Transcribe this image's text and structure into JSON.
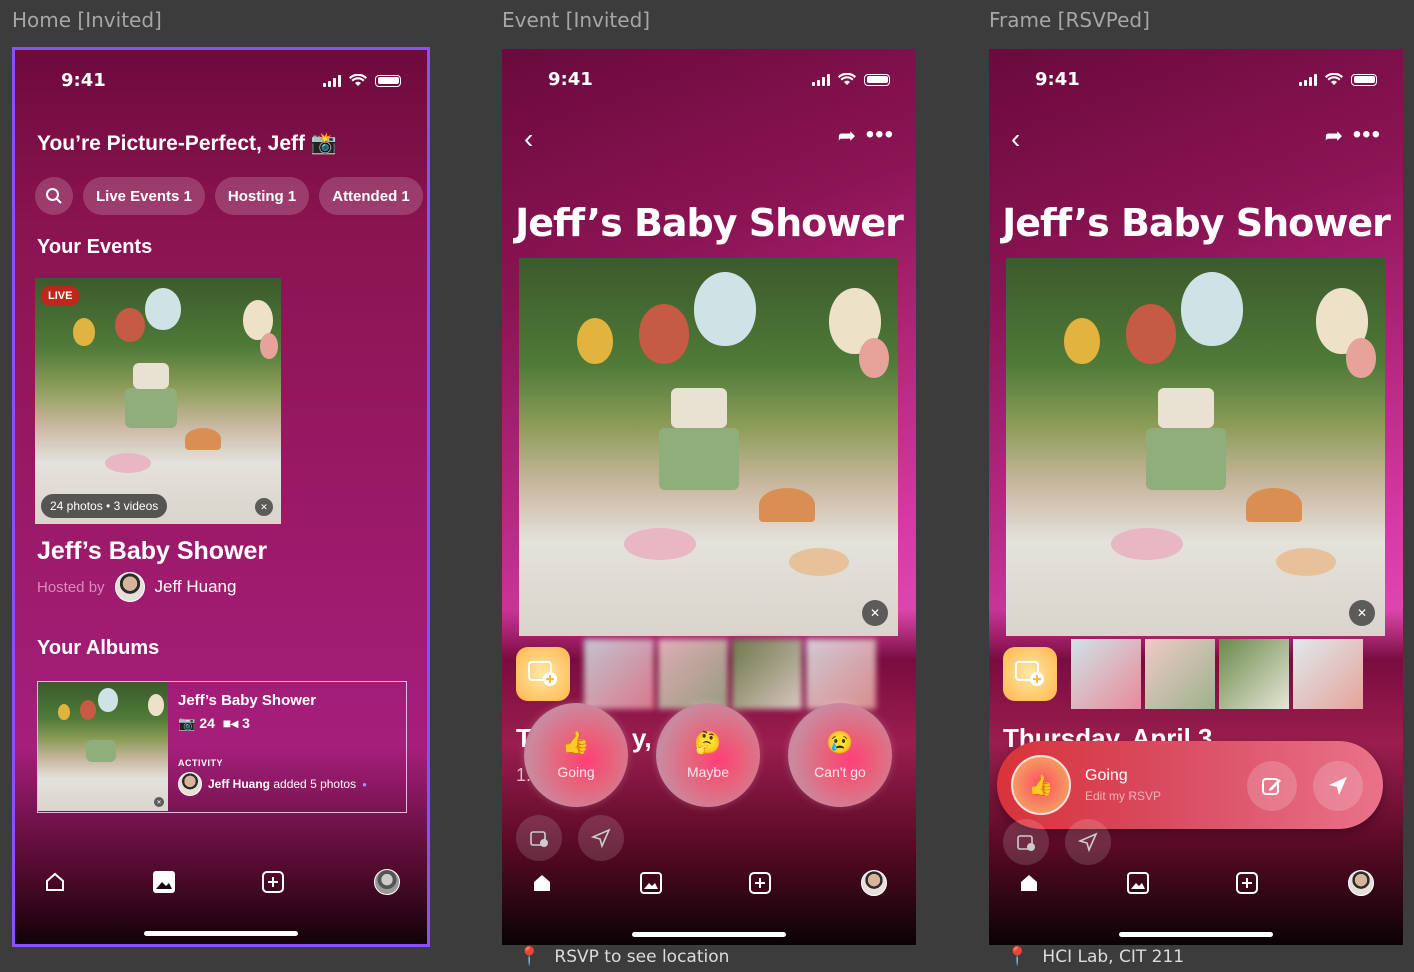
{
  "frames": {
    "home": "Home [Invited]",
    "event": "Event [Invited]",
    "rsvped": "Frame [RSVPed]"
  },
  "status": {
    "time": "9:41"
  },
  "home": {
    "greeting": "You’re Picture-Perfect, Jeff 📸",
    "chips": [
      "Live Events 1",
      "Hosting 1",
      "Attended 1"
    ],
    "your_events": "Your Events",
    "live_badge": "LIVE",
    "media_count": "24 photos • 3 videos",
    "event_title": "Jeff’s Baby Shower",
    "hosted_by": "Hosted by",
    "host_name": "Jeff Huang",
    "your_albums": "Your Albums",
    "album": {
      "title": "Jeff’s Baby Shower",
      "photos": "24",
      "videos": "3",
      "activity_label": "ACTIVITY",
      "activity_user": "Jeff Huang",
      "activity_text": "added 5 photos"
    }
  },
  "event": {
    "title": "Jeff’s Baby Shower",
    "date_partial": "T",
    "date_partial2": "y, A",
    "time_partial": "1:",
    "rsvp": [
      {
        "label": "Going",
        "emoji": "👍"
      },
      {
        "label": "Maybe",
        "emoji": "🤔"
      },
      {
        "label": "Can't go",
        "emoji": "😢"
      }
    ],
    "location_note": "RSVP to see location"
  },
  "rsvped": {
    "title": "Jeff’s Baby Shower",
    "date": "Thursday, April 3",
    "status": "Going",
    "edit": "Edit my RSVP",
    "location": "HCI Lab, CIT 211"
  },
  "colors": {
    "accent": "#8a4fff",
    "live": "#c0271c"
  }
}
